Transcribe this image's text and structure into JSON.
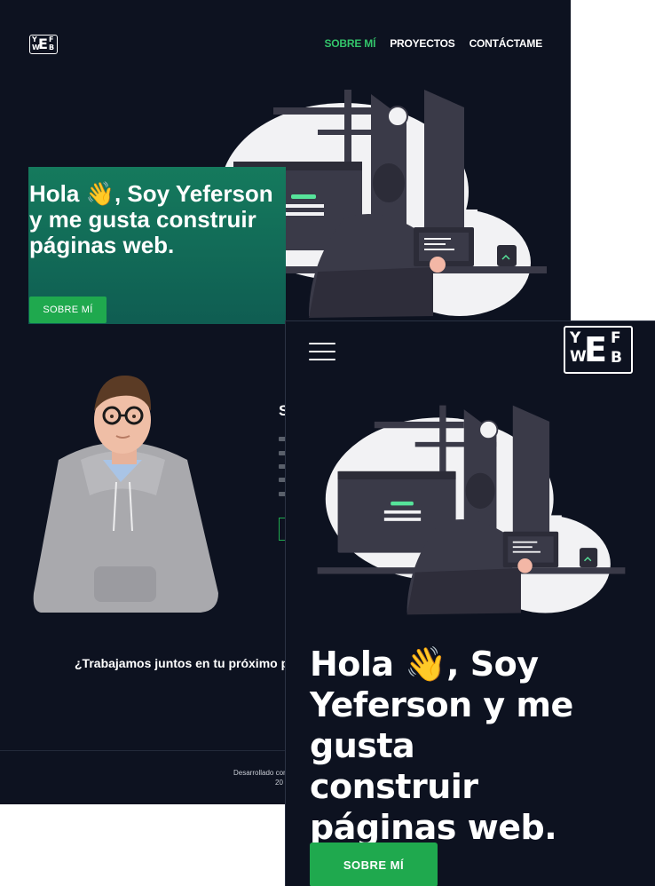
{
  "brand": {
    "logo_letters": {
      "y": "Y",
      "e": "E",
      "f": "F",
      "w": "W",
      "b": "B"
    }
  },
  "desktop": {
    "nav": [
      {
        "label": "SOBRE MÍ",
        "active": true
      },
      {
        "label": "PROYECTOS",
        "active": false
      },
      {
        "label": "CONTÁCTAME",
        "active": false
      }
    ],
    "hero": {
      "title_before_emoji": "Hola ",
      "emoji": "👋",
      "title_after_emoji": ", Soy Yeferson y me gusta construir páginas web.",
      "button": "SOBRE MÍ"
    },
    "about": {
      "heading": "S"
    },
    "cta": "¿Trabajamos juntos en tu próximo pr",
    "footer": {
      "line1": "Desarrollado con",
      "line2": "20"
    }
  },
  "mobile": {
    "menu_icon": "hamburger-menu-icon",
    "hero": {
      "title_before_emoji": "Hola ",
      "emoji": "👋",
      "title_after_emoji": ", Soy Yeferson y me gusta construir páginas web.",
      "button": "SOBRE MÍ"
    }
  },
  "colors": {
    "background": "#0d1220",
    "accent_green": "#1fa94e",
    "nav_active": "#33c46a",
    "hero_gradient_top": "#157a5d",
    "hero_gradient_bottom": "#0f5d52"
  }
}
